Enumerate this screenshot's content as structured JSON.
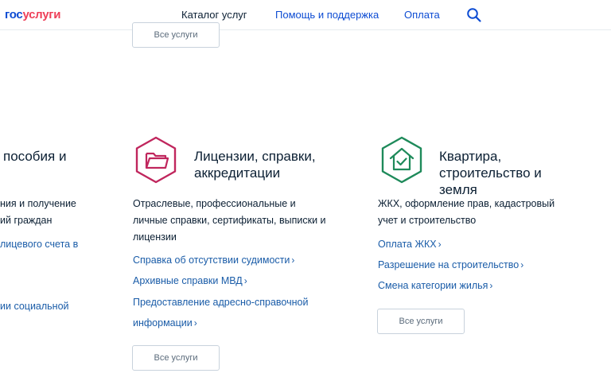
{
  "header": {
    "logo_part1": "гос",
    "logo_part2": "услуги",
    "nav": [
      "Каталог услуг",
      "Помощь и поддержка",
      "Оплата"
    ],
    "search_icon": "search-icon"
  },
  "top_button": "Все услуги",
  "col1": {
    "title": "пособия и",
    "desc": [
      "ния и получение",
      "ий граждан"
    ],
    "links": [
      "лицевого счета в",
      "ии социальной"
    ]
  },
  "col2": {
    "icon": "folder-icon",
    "icon_color": "#c0265d",
    "title": [
      "Лицензии, справки,",
      "аккредитации"
    ],
    "desc": [
      "Отраслевые, профессиональные и",
      "личные справки, сертификаты, выписки и",
      "лицензии"
    ],
    "links": [
      "Справка об отсутствии судимости",
      "Архивные справки МВД",
      "Предоставление адресно-справочной",
      "информации"
    ],
    "button": "Все услуги"
  },
  "col3": {
    "icon": "house-check-icon",
    "icon_color": "#1e8a5a",
    "title": [
      "Квартира,",
      "строительство и",
      "земля"
    ],
    "desc": [
      "ЖКХ, оформление прав, кадастровый",
      "учет и строительство"
    ],
    "links": [
      "Оплата ЖКХ",
      "Разрешение на строительство",
      "Смена категории жилья"
    ],
    "button": "Все услуги"
  },
  "chevron": "›"
}
